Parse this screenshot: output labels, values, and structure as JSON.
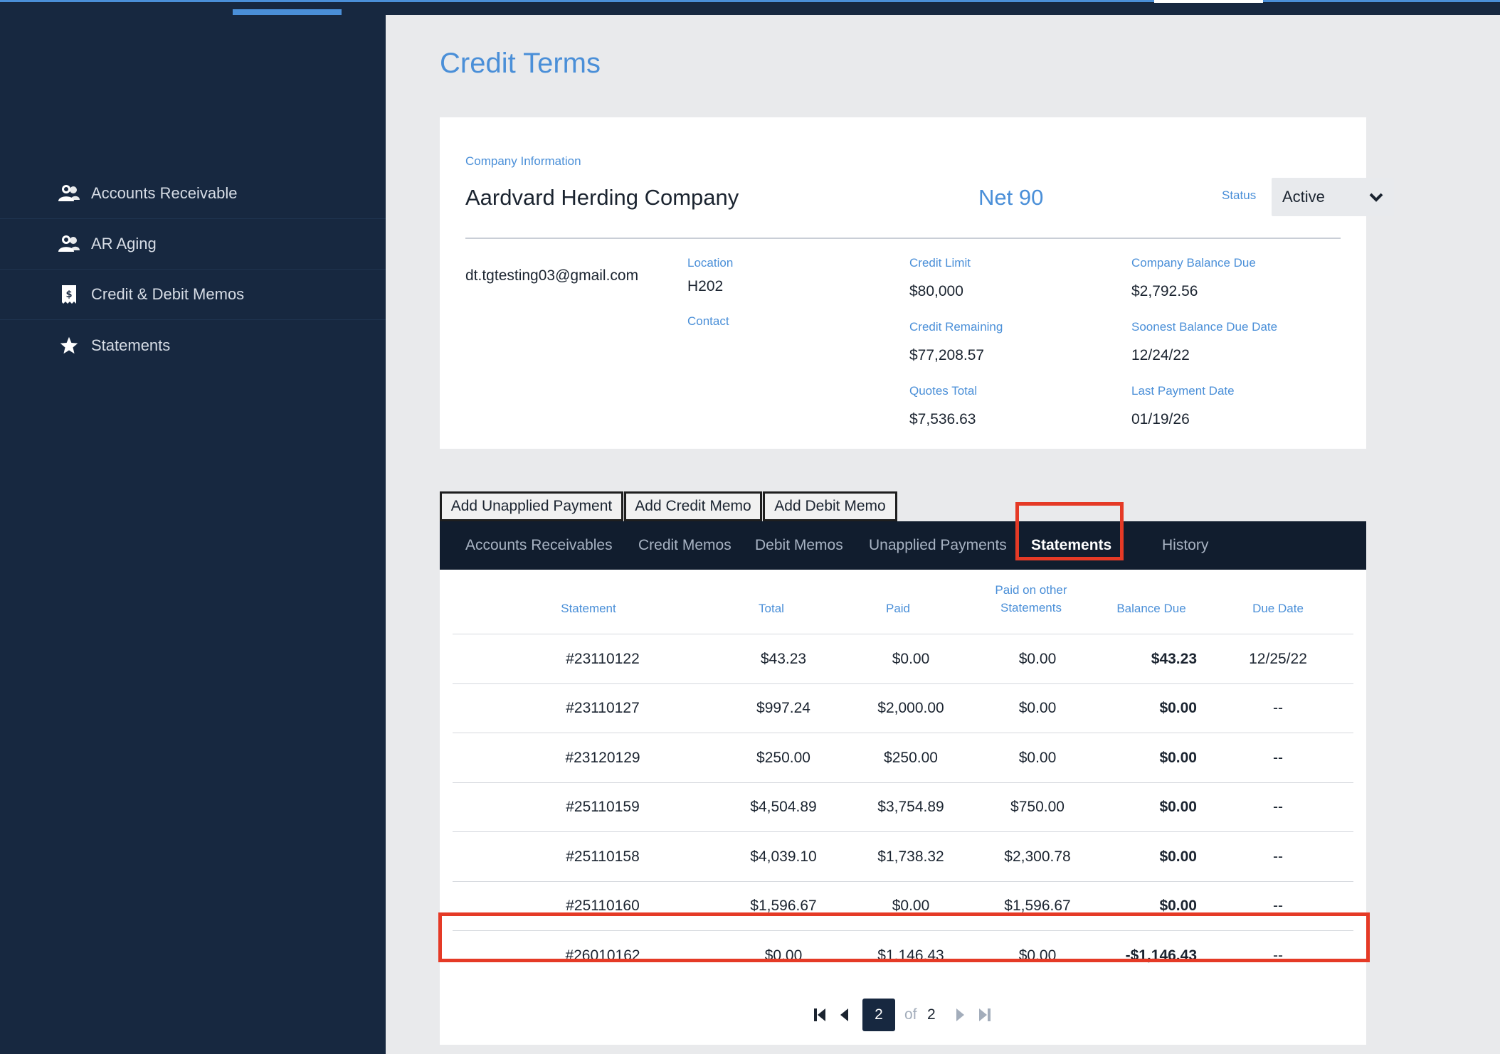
{
  "sidebar": {
    "items": [
      {
        "label": "Accounts Receivable",
        "icon": "users-icon"
      },
      {
        "label": "AR Aging",
        "icon": "users-icon"
      },
      {
        "label": "Credit & Debit Memos",
        "icon": "receipt-icon"
      },
      {
        "label": "Statements",
        "icon": "star-icon"
      }
    ]
  },
  "page": {
    "title": "Credit Terms"
  },
  "company": {
    "section_label": "Company Information",
    "name": "Aardvard Herding Company",
    "terms": "Net 90",
    "status_label": "Status",
    "status_value": "Active",
    "email": "dt.tgtesting03@gmail.com",
    "location_label": "Location",
    "location_value": "H202",
    "contact_label": "Contact",
    "credit_limit_label": "Credit Limit",
    "credit_limit_value": "$80,000",
    "credit_remaining_label": "Credit Remaining",
    "credit_remaining_value": "$77,208.57",
    "quotes_total_label": "Quotes Total",
    "quotes_total_value": "$7,536.63",
    "balance_due_label": "Company Balance Due",
    "balance_due_value": "$2,792.56",
    "soonest_due_label": "Soonest Balance Due Date",
    "soonest_due_value": "12/24/22",
    "last_payment_label": "Last Payment Date",
    "last_payment_value": "01/19/26"
  },
  "actions": {
    "add_unapplied_payment": "Add Unapplied Payment",
    "add_credit_memo": "Add Credit Memo",
    "add_debit_memo": "Add Debit Memo"
  },
  "tabs": [
    "Accounts Receivables",
    "Credit Memos",
    "Debit Memos",
    "Unapplied Payments",
    "Statements",
    "History"
  ],
  "active_tab": "Statements",
  "table": {
    "headers": {
      "statement": "Statement",
      "total": "Total",
      "paid": "Paid",
      "paid_other_1": "Paid on other",
      "paid_other_2": "Statements",
      "balance_due": "Balance Due",
      "due_date": "Due Date"
    },
    "rows": [
      {
        "statement": "#23110122",
        "total": "$43.23",
        "paid": "$0.00",
        "paid_other": "$0.00",
        "balance_due": "$43.23",
        "due_date": "12/25/22"
      },
      {
        "statement": "#23110127",
        "total": "$997.24",
        "paid": "$2,000.00",
        "paid_other": "$0.00",
        "balance_due": "$0.00",
        "due_date": "--"
      },
      {
        "statement": "#23120129",
        "total": "$250.00",
        "paid": "$250.00",
        "paid_other": "$0.00",
        "balance_due": "$0.00",
        "due_date": "--"
      },
      {
        "statement": "#25110159",
        "total": "$4,504.89",
        "paid": "$3,754.89",
        "paid_other": "$750.00",
        "balance_due": "$0.00",
        "due_date": "--"
      },
      {
        "statement": "#25110158",
        "total": "$4,039.10",
        "paid": "$1,738.32",
        "paid_other": "$2,300.78",
        "balance_due": "$0.00",
        "due_date": "--"
      },
      {
        "statement": "#25110160",
        "total": "$1,596.67",
        "paid": "$0.00",
        "paid_other": "$1,596.67",
        "balance_due": "$0.00",
        "due_date": "--"
      },
      {
        "statement": "#26010162",
        "total": "$0.00",
        "paid": "$1,146.43",
        "paid_other": "$0.00",
        "balance_due": "-$1,146.43",
        "due_date": "--"
      }
    ]
  },
  "pager": {
    "current": "2",
    "of_label": "of",
    "total": "2"
  },
  "colors": {
    "accent": "#4a8fd8",
    "sidebar": "#172840",
    "tabbar": "#111d2e",
    "highlight": "#e53a26"
  }
}
